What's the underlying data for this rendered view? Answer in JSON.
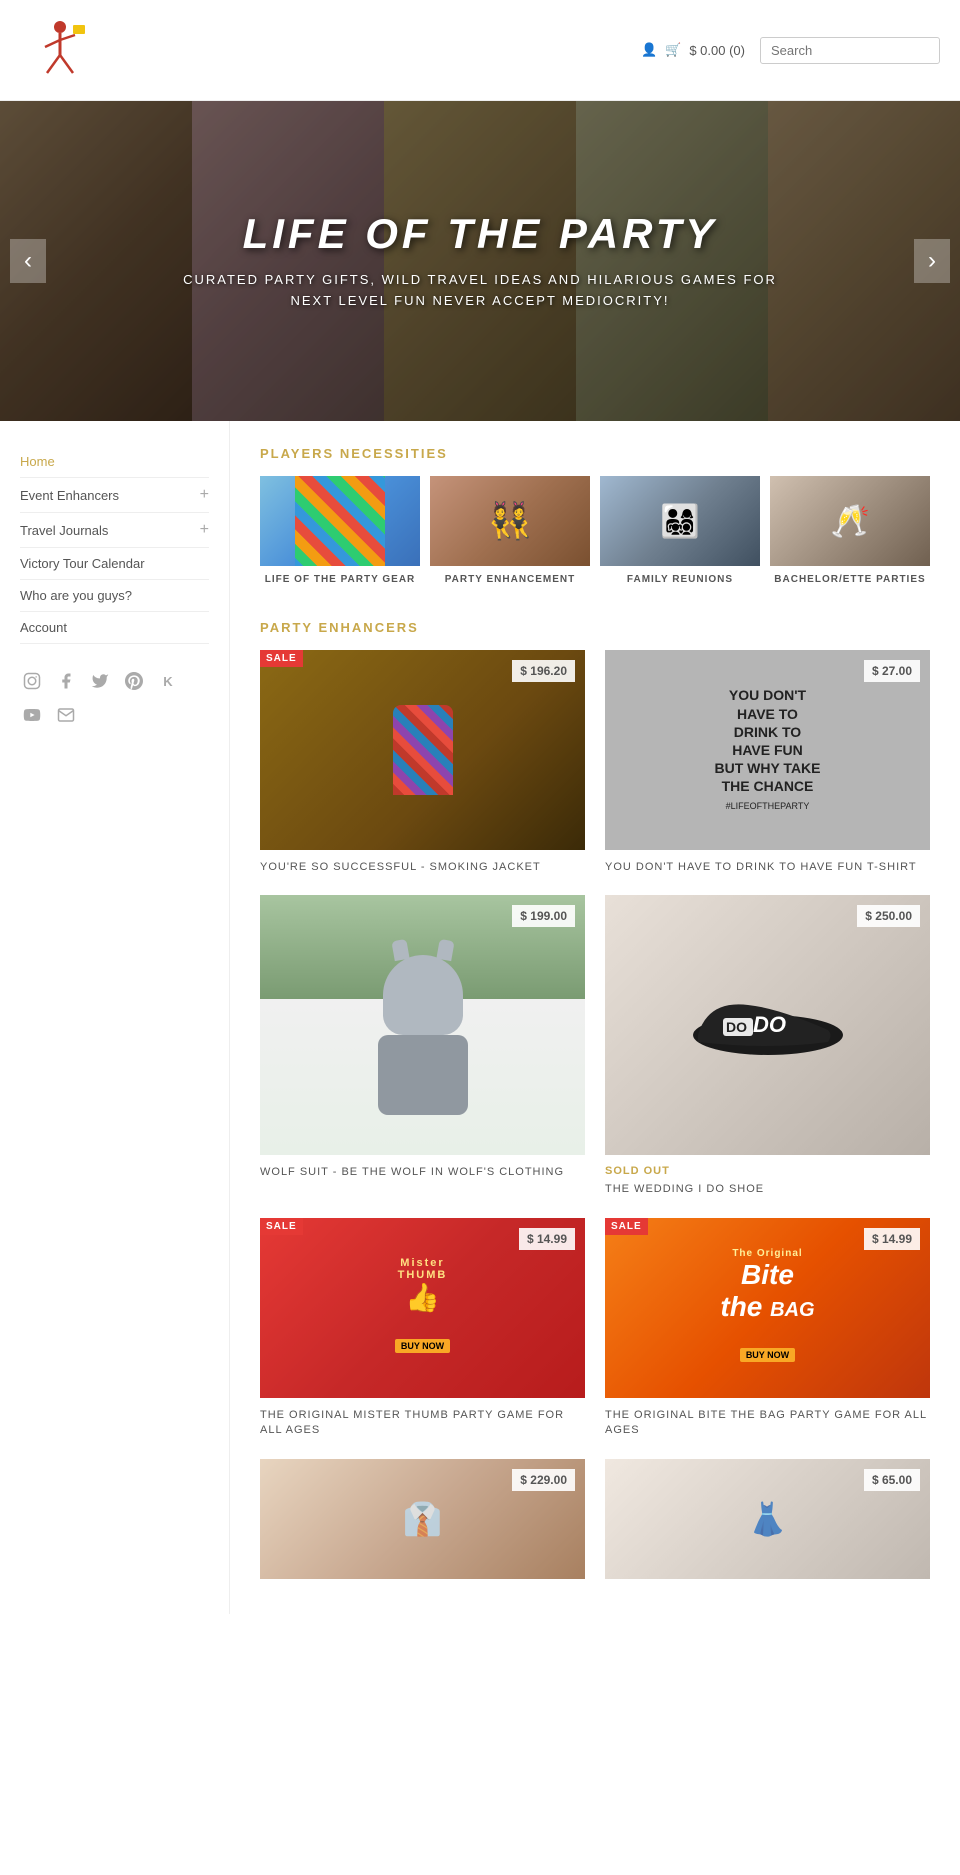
{
  "header": {
    "cart_text": "$ 0.00 (0)",
    "search_placeholder": "Search"
  },
  "hero": {
    "title": "LIFE OF THE PARTY",
    "subtitle": "CURATED PARTY GIFTS, WILD TRAVEL IDEAS AND HILARIOUS GAMES FOR NEXT LEVEL FUN NEVER ACCEPT MEDIOCRITY!",
    "arrow_left": "‹",
    "arrow_right": "›"
  },
  "sidebar": {
    "home_label": "Home",
    "nav_items": [
      {
        "label": "Event Enhancers",
        "has_plus": true
      },
      {
        "label": "Travel Journals",
        "has_plus": true
      },
      {
        "label": "Victory Tour Calendar",
        "has_plus": false
      },
      {
        "label": "Who are you guys?",
        "has_plus": false
      },
      {
        "label": "Account",
        "has_plus": false
      }
    ],
    "social_icons": [
      "instagram",
      "facebook",
      "twitter",
      "pinterest",
      "kickstarter",
      "youtube",
      "email"
    ]
  },
  "players_necessities": {
    "section_title": "PLAYERS NECESSITIES",
    "categories": [
      {
        "label": "LIFE OF THE PARTY GEAR"
      },
      {
        "label": "PARTY ENHANCEMENT"
      },
      {
        "label": "FAMILY REUNIONS"
      },
      {
        "label": "BACHELOR/ETTE PARTIES"
      }
    ]
  },
  "party_enhancers": {
    "section_title": "PARTY ENHANCERS",
    "products": [
      {
        "name": "YOU'RE SO SUCCESSFUL - SMOKING JACKET",
        "price": "$ 196.20",
        "sale": true,
        "sold_out": false
      },
      {
        "name": "YOU DON'T HAVE TO DRINK TO HAVE FUN T-SHIRT",
        "price": "$ 27.00",
        "sale": false,
        "sold_out": false
      },
      {
        "name": "WOLF SUIT - BE THE WOLF IN WOLF'S CLOTHING",
        "price": "$ 199.00",
        "sale": false,
        "sold_out": false
      },
      {
        "name": "THE WEDDING I DO SHOE",
        "price": "$ 250.00",
        "sale": false,
        "sold_out": true,
        "sold_out_label": "SOLD OUT"
      },
      {
        "name": "THE ORIGINAL MISTER THUMB PARTY GAME FOR ALL AGES",
        "price": "$ 14.99",
        "sale": true,
        "sold_out": false
      },
      {
        "name": "THE ORIGINAL BITE THE BAG PARTY GAME FOR ALL AGES",
        "price": "$ 14.99",
        "sale": true,
        "sold_out": false
      },
      {
        "name": "",
        "price": "$ 229.00",
        "sale": false,
        "sold_out": false
      },
      {
        "name": "",
        "price": "$ 65.00",
        "sale": false,
        "sold_out": false
      }
    ]
  }
}
